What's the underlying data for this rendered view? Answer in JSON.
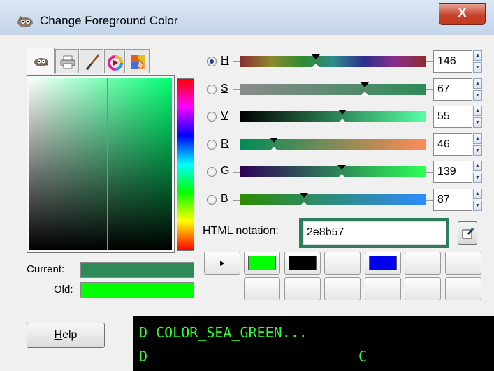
{
  "window": {
    "title": "Change Foreground Color",
    "close_label": "X"
  },
  "colors": {
    "current": "#2e8b57",
    "old": "#00ff00",
    "accent_frame": "#2e7d5b"
  },
  "tabs": [
    {
      "icon": "gimp-icon",
      "active": true
    },
    {
      "icon": "printer-icon",
      "active": false
    },
    {
      "icon": "brush-icon",
      "active": false
    },
    {
      "icon": "color-wheel-icon",
      "active": false
    },
    {
      "icon": "palette-icon",
      "active": false
    }
  ],
  "channels": [
    {
      "label": "H",
      "value": "146",
      "checked": true,
      "fraction": 0.405
    },
    {
      "label": "S",
      "value": "67",
      "checked": false,
      "fraction": 0.67
    },
    {
      "label": "V",
      "value": "55",
      "checked": false,
      "fraction": 0.55
    },
    {
      "label": "R",
      "value": "46",
      "checked": false,
      "fraction": 0.18
    },
    {
      "label": "G",
      "value": "139",
      "checked": false,
      "fraction": 0.545
    },
    {
      "label": "B",
      "value": "87",
      "checked": false,
      "fraction": 0.341
    }
  ],
  "html_notation": {
    "label_prefix": "HTML ",
    "label_underlined": "n",
    "label_suffix": "otation:",
    "value": "2e8b57"
  },
  "history": {
    "row1": [
      "#00ff00",
      "#000000",
      null,
      "#0000ee",
      null,
      null
    ],
    "row2": [
      null,
      null,
      null,
      null,
      null,
      null
    ]
  },
  "labels": {
    "current": "Current:",
    "old": "Old:",
    "help_prefix": "",
    "help_underlined": "H",
    "help_suffix": "elp"
  },
  "terminal": {
    "line1": "D COLOR_SEA_GREEN...",
    "line2_left": "D",
    "line2_right": "C"
  }
}
